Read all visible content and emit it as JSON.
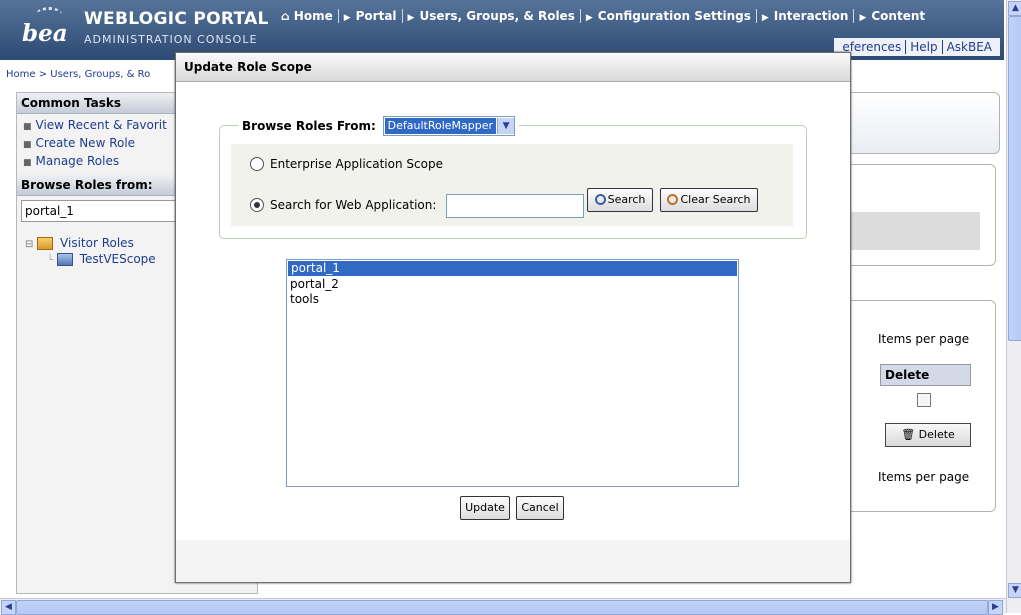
{
  "header": {
    "logo_text": "bea",
    "product_title": "WEBLOGIC PORTAL",
    "product_subtitle": "ADMINISTRATION CONSOLE",
    "nav": [
      "Home",
      "Portal",
      "Users, Groups, & Roles",
      "Configuration Settings",
      "Interaction",
      "Content"
    ],
    "util_links": [
      "eferences",
      "Help",
      "AskBEA"
    ]
  },
  "breadcrumb": "Home > Users, Groups, & Ro",
  "sidebar": {
    "tasks_heading": "Common Tasks",
    "tasks": [
      "View Recent & Favorit",
      "Create New Role",
      "Manage Roles"
    ],
    "browse_heading": "Browse Roles from:",
    "browse_value": "portal_1",
    "tree": {
      "root": "Visitor Roles",
      "child": "TestVEScope"
    }
  },
  "content": {
    "items_per_page_top": "Items per page",
    "delete_header": "Delete",
    "delete_button": "Delete",
    "items_per_page_bottom": "Items per page"
  },
  "dialog": {
    "title": "Update Role Scope",
    "browse_label": "Browse Roles From:",
    "browse_select_value": "DefaultRoleMapper",
    "enterprise_option": "Enterprise Application Scope",
    "webapp_option": "Search for Web Application:",
    "webapp_search_value": "",
    "search_button": "Search",
    "clear_search_button": "Clear Search",
    "apps": [
      "portal_1",
      "portal_2",
      "tools"
    ],
    "selected_app": "portal_1",
    "selected_scope": "web_application",
    "update_button": "Update",
    "cancel_button": "Cancel"
  },
  "colors": {
    "header_blue": "#2d4a74",
    "selection_blue": "#316ac5",
    "link_blue": "#1f3c8f",
    "fieldset_border": "#b9d1b4"
  }
}
